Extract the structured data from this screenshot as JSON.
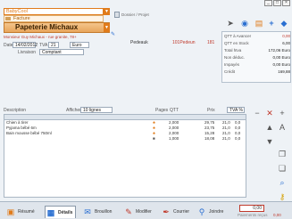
{
  "window": {
    "minimize": "_",
    "maximize": "□",
    "close": "×"
  },
  "header": {
    "company": "BabyCool",
    "doc_type": "Facture",
    "client": "Papeterie Michaux",
    "contact": "Monsieur Guy Michaux - rue granite, 78+",
    "date_label": "Date",
    "date_value": "14/02/2012",
    "tva_label": "TVA",
    "tva_value": "21",
    "euro_value": "Euro",
    "livraison_label": "Livraison",
    "livraison_value": "Comptant",
    "doc_project": "Dossier / Projet",
    "pedeauk": "Pedeauk",
    "pedeaun": "101Pedeun",
    "num": "181"
  },
  "totals": {
    "tva_rows": [
      {
        "label": "QTT à Avancer",
        "value": "0,00"
      },
      {
        "label": "QTT en Stock",
        "value": "6,00"
      },
      {
        "label": "Total htva",
        "value": "172,06 Euro"
      },
      {
        "label": "Non déduc.",
        "value": "0,00 Euro"
      },
      {
        "label": "Impayés",
        "value": "0,00 Euro"
      },
      {
        "label": "Crédit",
        "value": "169,88"
      }
    ]
  },
  "table_bar": {
    "description_label": "Description",
    "affichier_label": "Afficher",
    "lines_select": "10 lignes",
    "pages_label": "Pages",
    "qtt_label": "QTT",
    "prix_label": "Prix",
    "tva_combo": "TVA %"
  },
  "table": {
    "columns": [
      "Description",
      "",
      "",
      "QTT",
      "Prix",
      "",
      ""
    ],
    "rows": [
      {
        "desc": "Chien à tirer",
        "qtt": "2,000",
        "prix": "29,75",
        "tva": "21,0",
        "rem": "0,0"
      },
      {
        "desc": "Pyjama bébé 6m",
        "qtt": "2,000",
        "prix": "23,75",
        "tva": "21,0",
        "rem": "0,0"
      },
      {
        "desc": "Bain mousse bébé 750ml",
        "qtt": "2,000",
        "prix": "15,28",
        "tva": "21,0",
        "rem": "0,0"
      },
      {
        "desc": "",
        "qtt": "1,000",
        "prix": "18,08",
        "tva": "21,0",
        "rem": "0,0"
      }
    ]
  },
  "bottom_tabs": [
    {
      "label": "Résumé",
      "icon": "document-icon"
    },
    {
      "label": "Détails",
      "icon": "details-icon"
    },
    {
      "label": "Brouillon",
      "icon": "draft-icon"
    },
    {
      "label": "Modifier",
      "icon": "edit-icon"
    },
    {
      "label": "Courrier",
      "icon": "mail-icon"
    },
    {
      "label": "Joindre",
      "icon": "attach-icon"
    }
  ],
  "bottom": {
    "total": "0,00",
    "label": "Paiements reçus",
    "value": "0,00"
  },
  "colors": {
    "accent": "#e07b1a",
    "alert": "#c0392b"
  }
}
